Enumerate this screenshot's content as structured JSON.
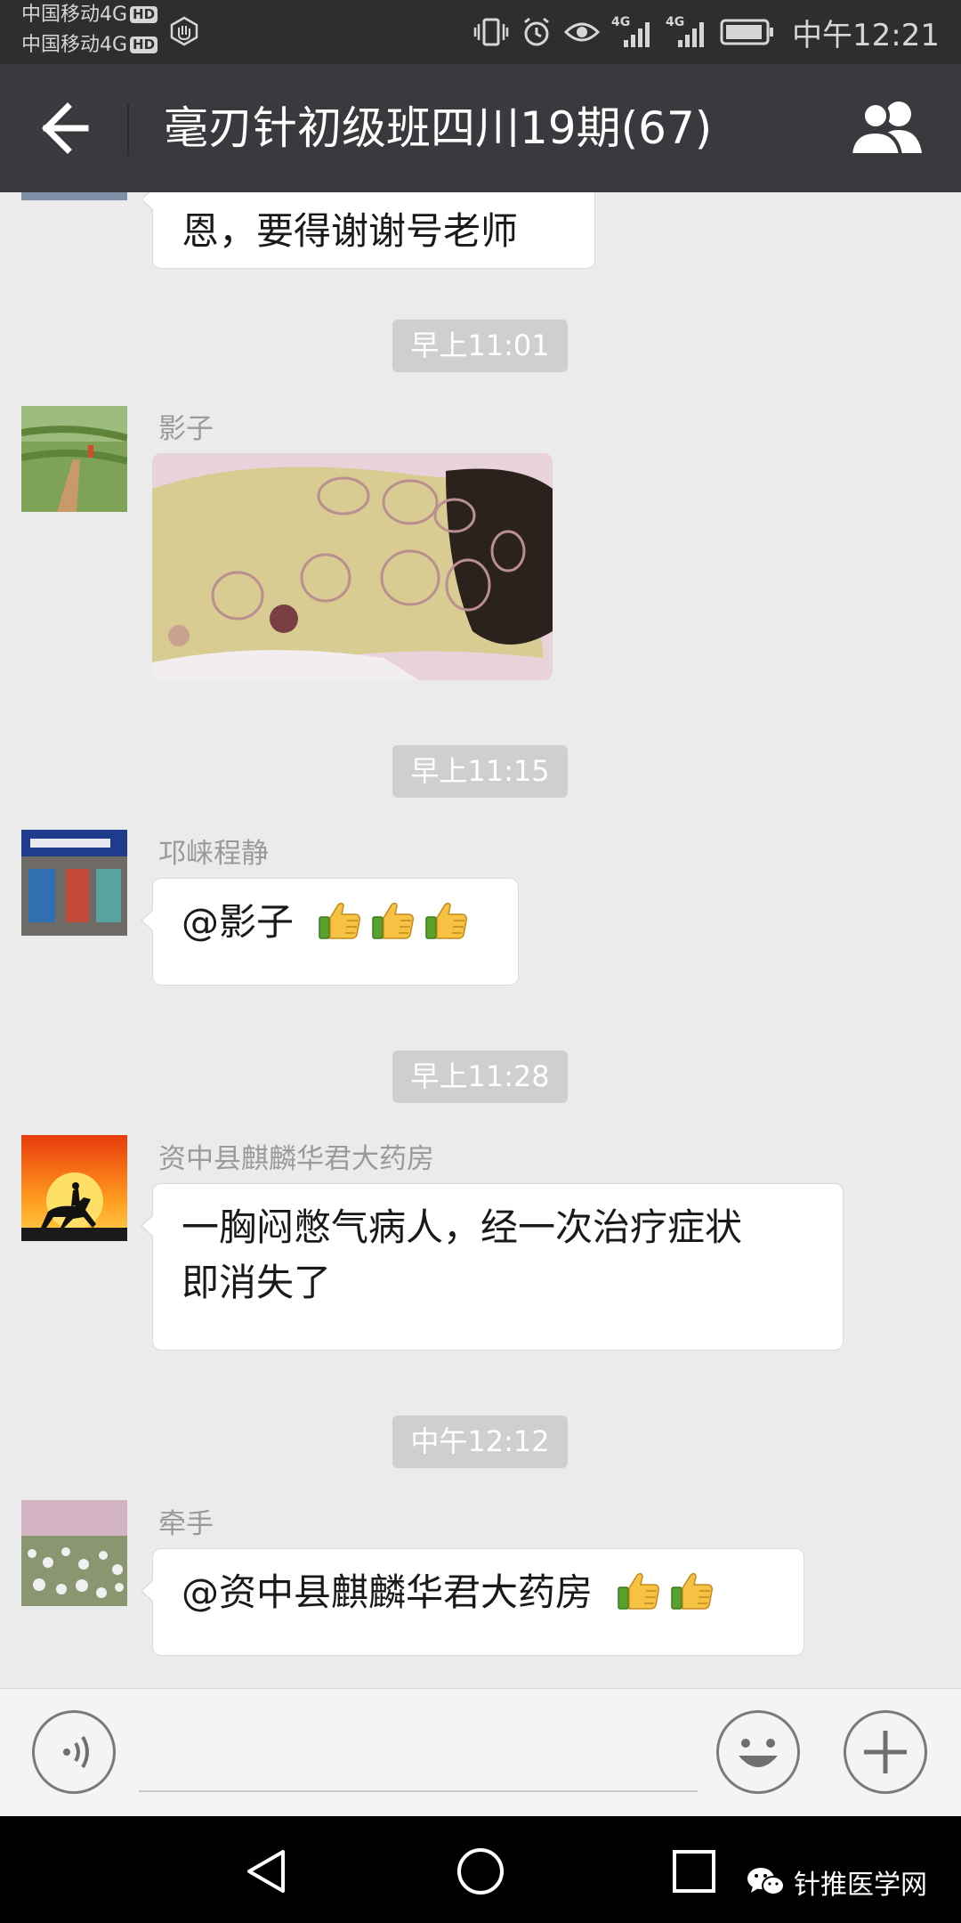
{
  "status_bar": {
    "carrier_1": "中国移动4G",
    "carrier_2": "中国移动4G",
    "hd_badge": "HD",
    "network_badge": "4G",
    "time": "中午12:21"
  },
  "title_bar": {
    "title": "毫刃针初级班四川19期(67)"
  },
  "messages": {
    "m0": {
      "text": "恩，要得谢谢号老师"
    },
    "t1": {
      "time": "早上11:01"
    },
    "m1": {
      "sender": "影子",
      "type": "image"
    },
    "t2": {
      "time": "早上11:15"
    },
    "m2": {
      "sender": "邛崃程静",
      "text": "@影子",
      "emoji_count": 3
    },
    "t3": {
      "time": "早上11:28"
    },
    "m3": {
      "sender": "资中县麒麟华君大药房",
      "line1": "一胸闷憋气病人，经一次治疗症状",
      "line2": "即消失了"
    },
    "t4": {
      "time": "中午12:12"
    },
    "m4": {
      "sender": "牵手",
      "text": "@资中县麒麟华君大药房",
      "emoji_count": 2
    }
  },
  "input_bar": {
    "placeholder": ""
  },
  "watermark": {
    "text": "针推医学网"
  },
  "icons": {
    "back": "arrow-left-icon",
    "members": "group-icon",
    "voice": "voice-icon",
    "emoji": "smiley-icon",
    "more": "plus-icon",
    "thumb": "thumbs-up-emoji",
    "nav_back": "triangle-back-icon",
    "nav_home": "circle-home-icon",
    "nav_recent": "square-recent-icon"
  },
  "colors": {
    "title_bar_bg": "#393a3e",
    "chat_bg": "#ebebeb",
    "bubble_bg": "#ffffff",
    "time_box_bg": "#cfcfcf"
  }
}
